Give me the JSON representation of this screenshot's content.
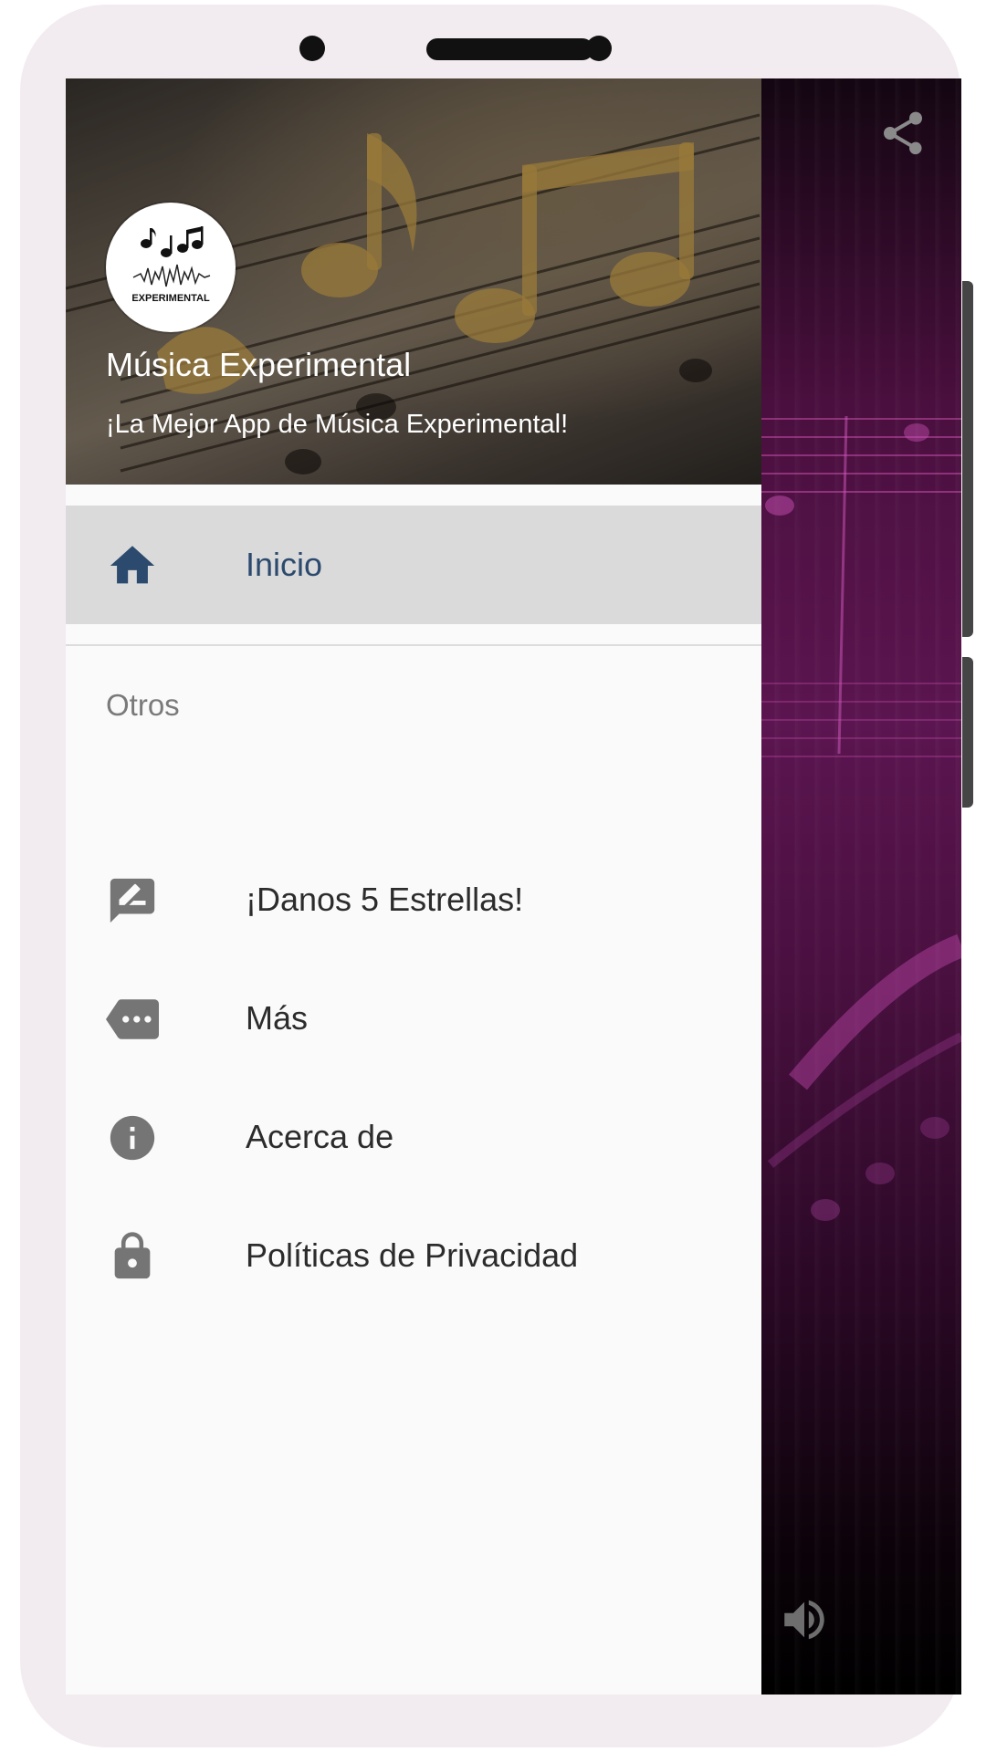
{
  "drawer": {
    "header": {
      "app_name": "Música Experimental",
      "tagline": "¡La Mejor App de Música Experimental!",
      "logo_text": "EXPERIMENTAL"
    },
    "main_items": [
      {
        "label": "Inicio",
        "icon": "home-icon",
        "active": true
      }
    ],
    "section_label": "Otros",
    "other_items": [
      {
        "label": "¡Danos 5 Estrellas!",
        "icon": "rate-review-icon"
      },
      {
        "label": "Más",
        "icon": "more-tag-icon"
      },
      {
        "label": "Acerca de",
        "icon": "info-icon"
      },
      {
        "label": "Políticas de Privacidad",
        "icon": "lock-icon"
      }
    ]
  },
  "content": {
    "share_icon": "share-icon",
    "volume_icon": "volume-icon"
  },
  "colors": {
    "active_item_bg": "#dadada",
    "active_item_text": "#2c4a6e",
    "drawer_bg": "#fafafa",
    "icon_gray": "#757575"
  }
}
